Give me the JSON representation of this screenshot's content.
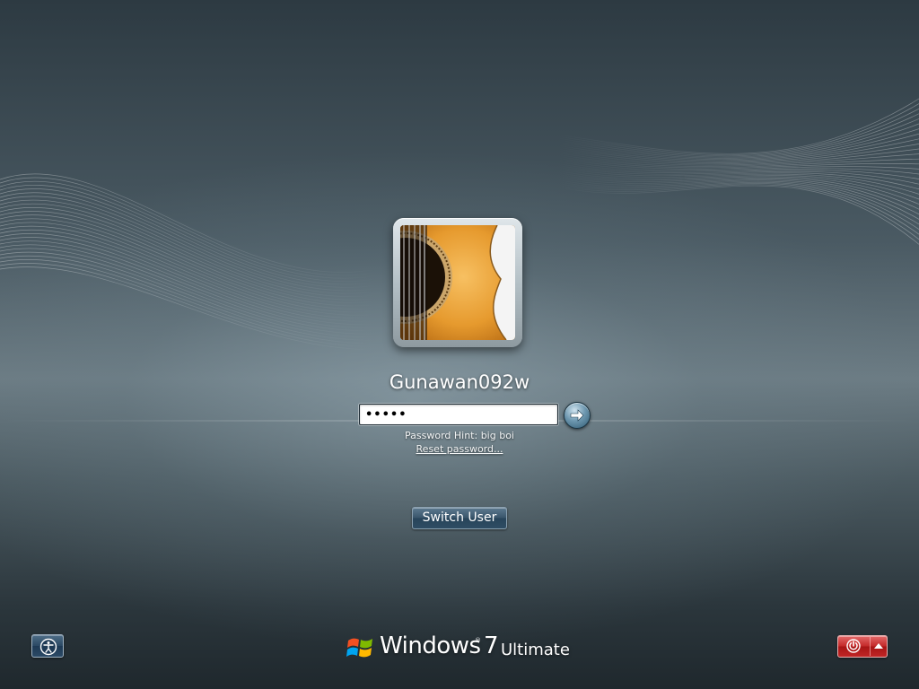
{
  "user": {
    "name": "Gunawan092w",
    "avatar_icon": "guitar-avatar-icon"
  },
  "password": {
    "value": "•••••",
    "hint_label": "Password Hint: big boi",
    "reset_link": "Reset password..."
  },
  "actions": {
    "switch_user_label": "Switch User"
  },
  "branding": {
    "product": "Windows",
    "reg_mark": "®",
    "version": "7",
    "edition": "Ultimate"
  },
  "icons": {
    "submit": "arrow-right-icon",
    "ease_of_access": "ease-of-access-icon",
    "power": "power-icon",
    "power_options": "chevron-up-icon",
    "logo": "windows-flag-icon"
  },
  "colors": {
    "power_accent": "#c42a2a",
    "button_accent": "#2f4d64"
  }
}
